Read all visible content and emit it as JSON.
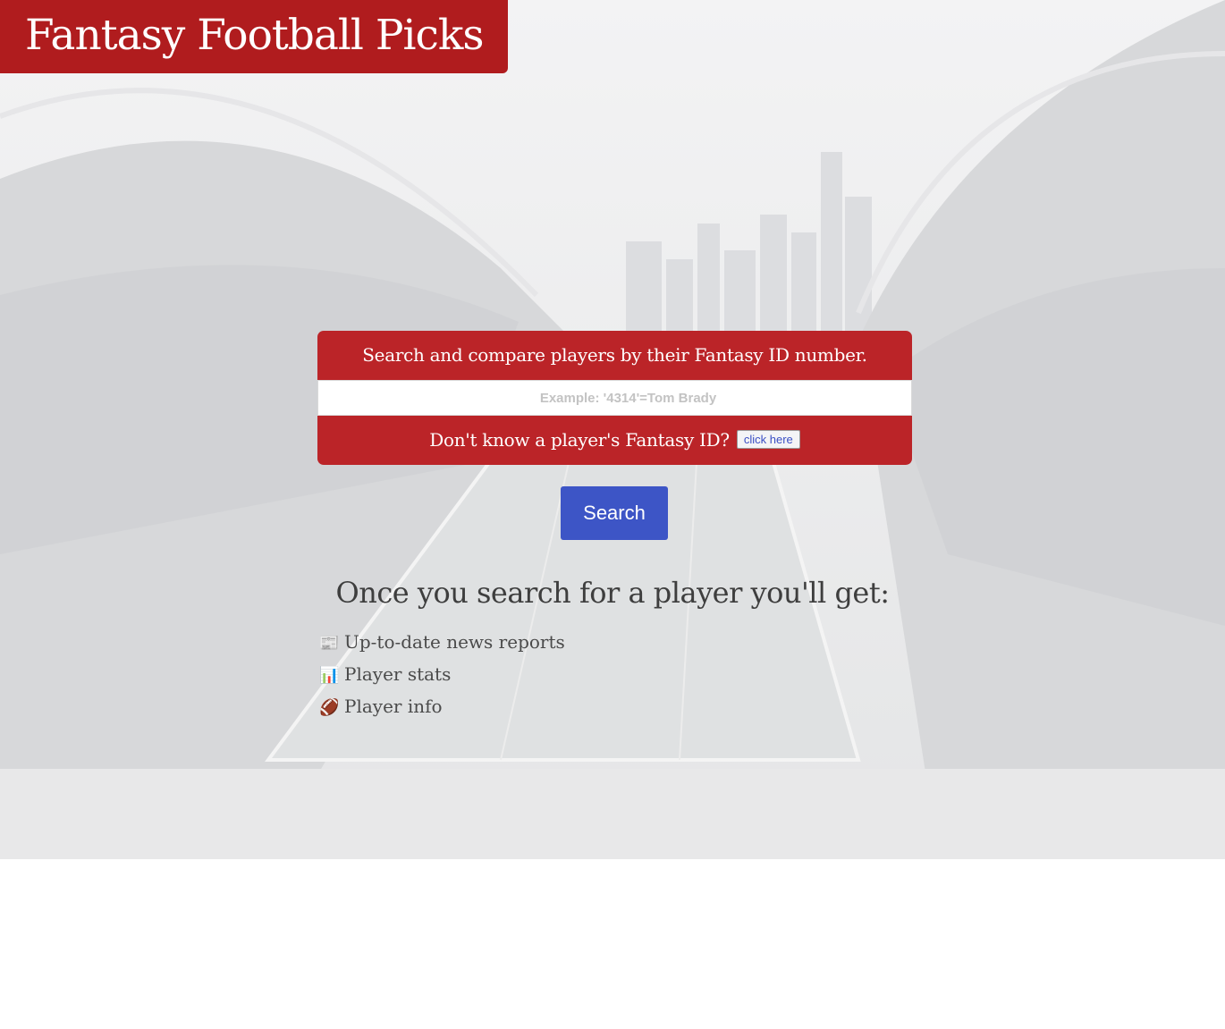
{
  "header": {
    "site_title": "Fantasy Football Picks"
  },
  "search_card": {
    "heading": "Search and compare players by their Fantasy ID number.",
    "input_placeholder": "Example: '4314'=Tom Brady",
    "input_value": "",
    "help_text": "Don't know a player's Fantasy ID?",
    "help_button_label": "click here"
  },
  "search_button_label": "Search",
  "benefits": {
    "heading": "Once you search for a player you'll get:",
    "items": [
      {
        "icon": "newspaper-icon",
        "glyph": "📰",
        "label": "Up-to-date news reports"
      },
      {
        "icon": "bar-chart-icon",
        "glyph": "📊",
        "label": "Player stats"
      },
      {
        "icon": "football-icon",
        "glyph": "🏈",
        "label": "Player info"
      }
    ]
  },
  "colors": {
    "brand_red": "#b01c1e",
    "card_red": "#bb2428",
    "button_blue": "#3d55c6",
    "text_gray": "#3e3e3e"
  }
}
